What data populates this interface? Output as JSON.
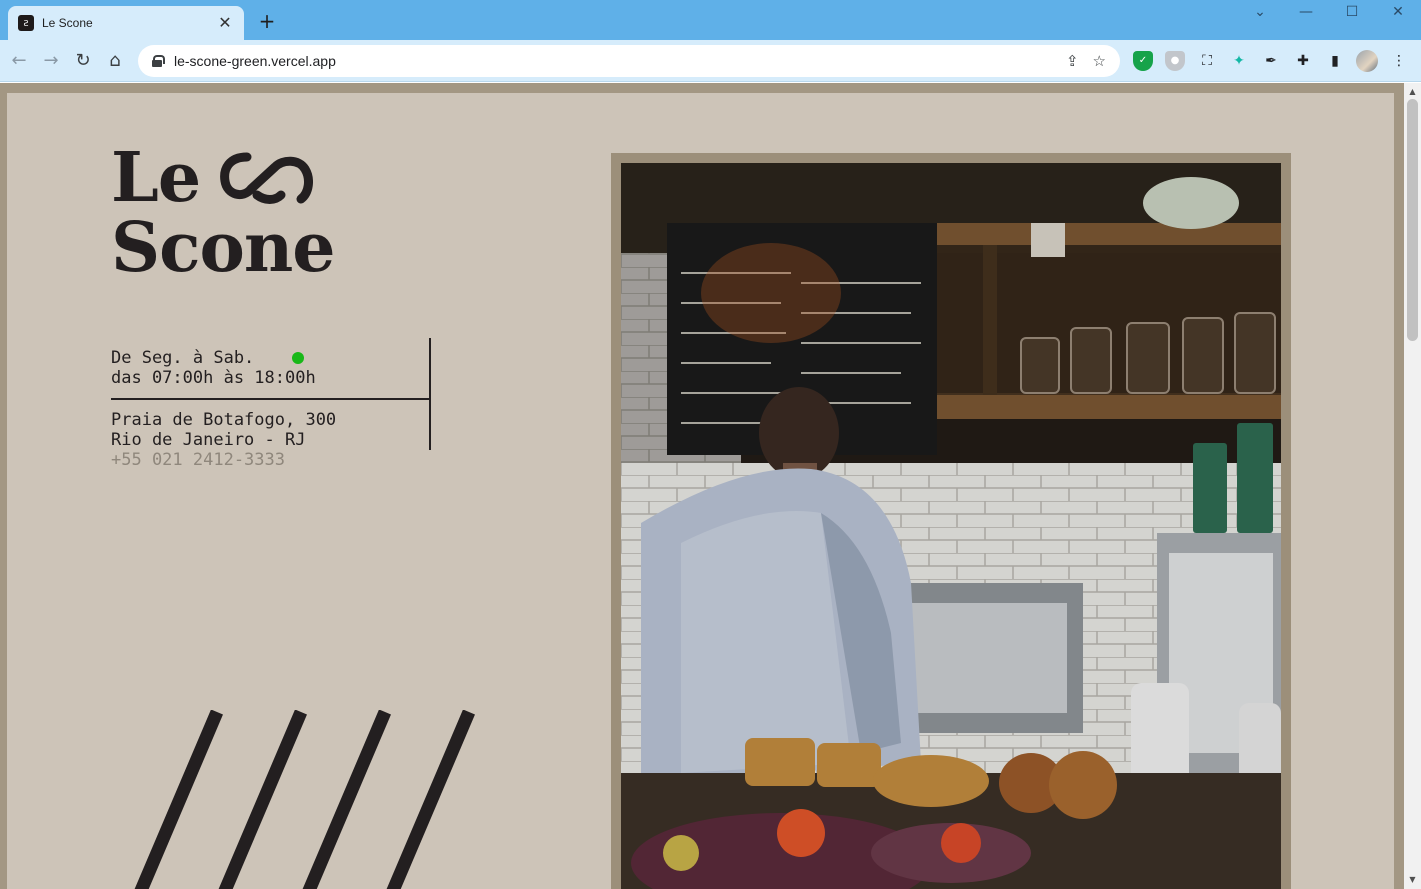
{
  "browser": {
    "tab_title": "Le Scone",
    "tab_favicon": "Ꙅ",
    "tab_close": "✕",
    "new_tab": "+",
    "url": "le-scone-green.vercel.app",
    "controls": {
      "chevron": "⌄",
      "minimize": "—",
      "maximize": "☐",
      "close": "✕"
    },
    "nav": {
      "back": "←",
      "forward": "→",
      "reload": "↻",
      "home": "⌂"
    },
    "omnibox_icons": {
      "share": "⇪",
      "bookmark": "☆"
    },
    "extensions": [
      "shield-extension-icon",
      "gray-shield-extension-icon",
      "screenshot-icon",
      "green-bird-icon",
      "eyedropper-icon",
      "puzzle-icon",
      "side-panel-icon"
    ],
    "ext_glyphs": {
      "shield": "✓",
      "gray": "●",
      "screenshot": "⛶",
      "bird": "✦",
      "eyedropper": "✒",
      "puzzle": "✚",
      "side_panel": "▮",
      "menu": "⋮"
    }
  },
  "site": {
    "logo_line1": "Le",
    "logo_line2": "Scone",
    "hours_line1": "De Seg. à Sab.",
    "hours_line2": "das 07:00h às 18:00h",
    "open_status_color": "#18b818",
    "address_line1": "Praia de Botafogo, 300",
    "address_line2": "Rio de Janeiro - RJ",
    "phone": "+55 021 2412-3333"
  },
  "colors": {
    "background": "#cdc4b8",
    "frame": "#a39783",
    "ink": "#231f20",
    "muted": "#8f877c"
  },
  "scrollbar": {
    "up": "▲",
    "down": "▼"
  }
}
